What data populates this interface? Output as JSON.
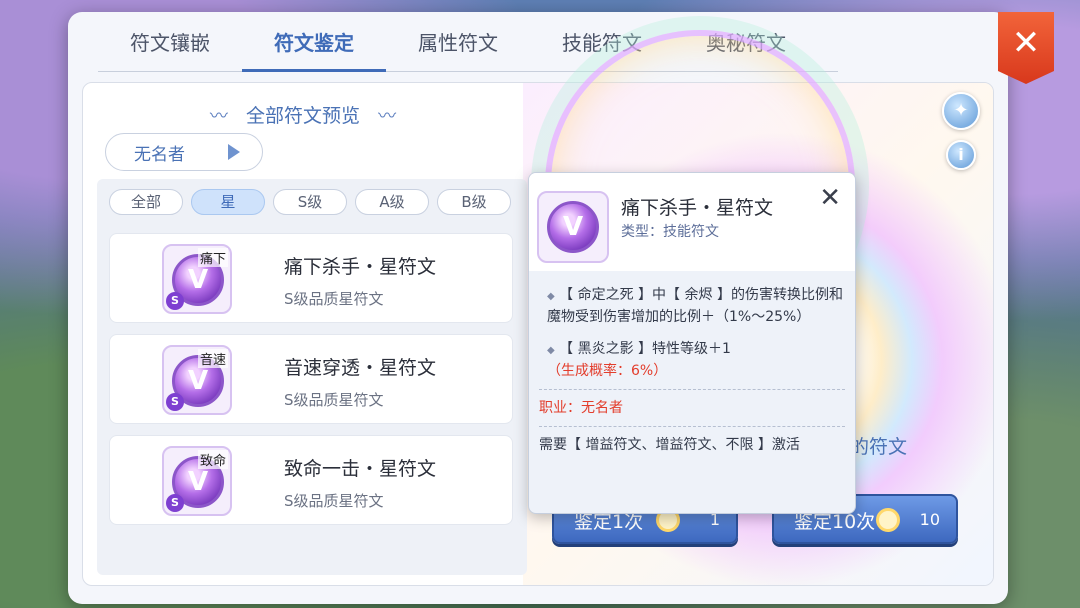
{
  "tabs": [
    "符文镶嵌",
    "符文鉴定",
    "属性符文",
    "技能符文",
    "奥秘符文"
  ],
  "active_tab": 1,
  "preview_title": "全部符文预览",
  "character": "无名者",
  "filters": [
    "全部",
    "星",
    "S级",
    "A级",
    "B级"
  ],
  "active_filter": 1,
  "runes": [
    {
      "name": "痛下杀手・星符文",
      "sub": "S级品质星符文",
      "tag": "痛下",
      "badge": "S"
    },
    {
      "name": "音速穿透・星符文",
      "sub": "S级品质星符文",
      "tag": "音速",
      "badge": "S"
    },
    {
      "name": "致命一击・星符文",
      "sub": "S级品质星符文",
      "tag": "致命",
      "badge": "S"
    }
  ],
  "buttons": {
    "appraise_once": "鉴定1次",
    "appraise_once_count": "1",
    "appraise_ten": "鉴定10次",
    "appraise_ten_count": "10"
  },
  "partial_text": "的符文",
  "popup": {
    "name": "痛下杀手・星符文",
    "type": "类型：技能符文",
    "line1": "【 命定之死 】中【 余烬 】的伤害转换比例和魔物受到伤害增加的比例＋（1%～25%）",
    "line2a": "【 黑炎之影 】特性等级＋1",
    "line2b": "（生成概率：6%）",
    "job": "职业：无名者",
    "require": "需要【 增益符文、增益符文、不限 】激活"
  },
  "close_symbol": "✕",
  "icons": {
    "wand": "wand-icon",
    "info": "info-icon"
  }
}
